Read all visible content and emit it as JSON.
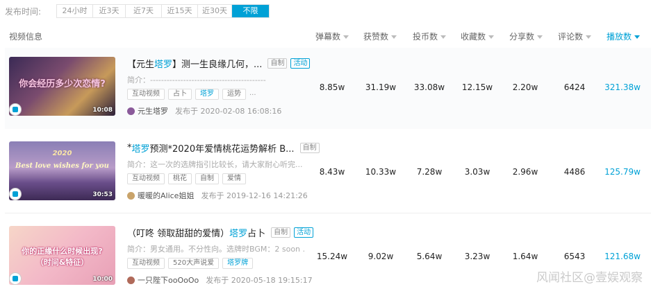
{
  "filter": {
    "label": "发布时间:",
    "options": [
      "24小时",
      "近3天",
      "近7天",
      "近15天",
      "近30天",
      "不限"
    ],
    "active": "不限"
  },
  "header": {
    "video_info": "视频信息",
    "danmaku": "弹幕数",
    "likes": "获赞数",
    "coins": "投币数",
    "favorites": "收藏数",
    "shares": "分享数",
    "comments": "评论数",
    "plays": "播放数"
  },
  "rows": [
    {
      "thumb_text": "你会经历多少次恋情?",
      "duration": "10:08",
      "title_prefix": "【元生",
      "title_hl": "塔罗",
      "title_suffix": "】测一生良缘几何，...",
      "self_tag": "自制",
      "activity_tag": "活动",
      "intro": "简介：------------------------------------------",
      "tags": [
        "互动视频",
        "占卜",
        "塔罗",
        "运势"
      ],
      "tags_more": "...",
      "author": "元生塔罗",
      "date": "发布于 2020-02-08 16:08:16",
      "danmaku": "8.85w",
      "likes": "31.19w",
      "coins": "33.08w",
      "favorites": "12.15w",
      "shares": "2.20w",
      "comments": "6424",
      "plays": "321.38w"
    },
    {
      "thumb_text": "Best love wishes for you",
      "thumb_year": "2020",
      "duration": "30:53",
      "title_prefix": "*",
      "title_hl": "塔罗",
      "title_suffix": "预测*2020年爱情桃花运势解析 B...",
      "self_tag": "自制",
      "intro": "简介：这一次的选牌指引比较长，请大家耐心听完...",
      "tags": [
        "互动视频",
        "桃花",
        "自制",
        "爱情"
      ],
      "author": "暖暖的Alice姐姐",
      "date": "发布于 2019-12-16 14:21:26",
      "danmaku": "8.43w",
      "likes": "10.33w",
      "coins": "7.28w",
      "favorites": "3.03w",
      "shares": "2.96w",
      "comments": "4486",
      "plays": "125.79w"
    },
    {
      "thumb_text_1": "你的正缘什么时候出现?",
      "thumb_text_2": "（时间&特征）",
      "duration": "10:00",
      "title_prefix": "（叮咚 领取甜甜的爱情）",
      "title_hl": "塔罗",
      "title_suffix": "占卜",
      "self_tag": "自制",
      "activity_tag": "活动",
      "intro": "简介：男女通用。不分性向。选牌时BGM：2 soon ...",
      "tags": [
        "互动视频",
        "520大声说爱",
        "塔罗牌"
      ],
      "author": "一只陛下ooOoOo",
      "date": "发布于 2020-05-18 19:15:17",
      "danmaku": "15.24w",
      "likes": "9.02w",
      "coins": "5.64w",
      "favorites": "3.23w",
      "shares": "1.64w",
      "comments": "6543",
      "plays": "121.68w"
    }
  ],
  "watermark": "风闻社区@壹娱观察",
  "colors": {
    "accent": "#00a1d6"
  }
}
